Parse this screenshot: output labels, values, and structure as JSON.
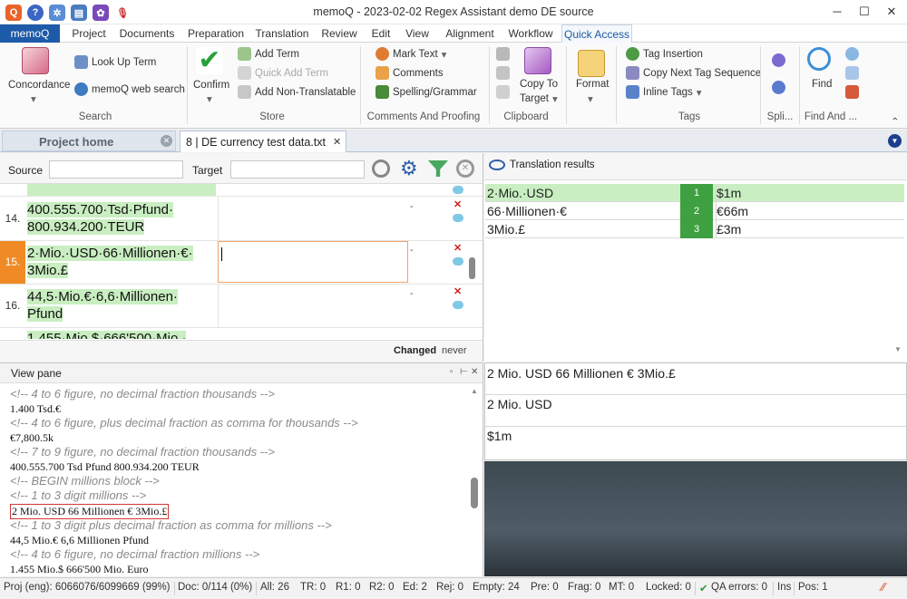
{
  "window": {
    "title": "memoQ - 2023-02-02 Regex Assistant demo DE source"
  },
  "ribbon_tabs": [
    "memoQ",
    "Project",
    "Documents",
    "Preparation",
    "Translation",
    "Review",
    "Edit",
    "View",
    "Alignment",
    "Workflow",
    "Quick Access"
  ],
  "active_tab": "Quick Access",
  "ribbon": {
    "search": {
      "concordance": "Concordance",
      "lookup": "Look Up Term",
      "web": "memoQ web search",
      "label": "Search"
    },
    "store": {
      "confirm": "Confirm",
      "add_term": "Add Term",
      "quick_add": "Quick Add Term",
      "add_nt": "Add Non-Translatable",
      "label": "Store"
    },
    "comments": {
      "mark": "Mark Text",
      "comments": "Comments",
      "spelling": "Spelling/Grammar",
      "label": "Comments And Proofing"
    },
    "clipboard": {
      "copy": "Copy To",
      "target": "Target",
      "label": "Clipboard"
    },
    "format": {
      "label": "Format"
    },
    "tags": {
      "insertion": "Tag Insertion",
      "copy_next": "Copy Next Tag Sequence",
      "inline": "Inline Tags",
      "label": "Tags"
    },
    "split": {
      "label": "Spli..."
    },
    "find": {
      "find": "Find",
      "label": "Find And ..."
    }
  },
  "doc_tabs": {
    "home": "Project home",
    "doc": "8 | DE currency test data.txt"
  },
  "filter": {
    "source_label": "Source",
    "target_label": "Target"
  },
  "grid": {
    "rows": [
      {
        "num": "14.",
        "source": "400.555.700·Tsd·Pfund· 800.934.200·TEUR",
        "status": "-"
      },
      {
        "num": "15.",
        "source": "2·Mio.·USD·66·Millionen·€· 3Mio.£",
        "status": "-"
      },
      {
        "num": "16.",
        "source": "44,5·Mio.€·6,6·Millionen· Pfund",
        "status": "-"
      },
      {
        "num": "",
        "source": "1.455·Mio.$·666'500·Mio.·",
        "status": ""
      }
    ],
    "changed_label": "Changed",
    "changed_value": "never"
  },
  "translation_results": {
    "title": "Translation results",
    "rows": [
      {
        "source": "2·Mio.·USD",
        "num": "1",
        "target": "$1m"
      },
      {
        "source": "66·Millionen·€",
        "num": "2",
        "target": "€66m"
      },
      {
        "source": "3Mio.£",
        "num": "3",
        "target": "£3m"
      }
    ]
  },
  "preview": {
    "line1": "2 Mio. USD 66 Millionen € 3Mio.£",
    "line2": "2 Mio. USD",
    "line3": "$1m"
  },
  "view_pane": {
    "title": "View pane",
    "lines": [
      {
        "type": "c",
        "text": "<!-- 4 to 6 figure, no decimal fraction thousands -->"
      },
      {
        "type": "d",
        "text": "1.400 Tsd.€"
      },
      {
        "type": "c",
        "text": "<!-- 4 to 6 figure, plus decimal fraction as comma for thousands -->"
      },
      {
        "type": "d",
        "text": "€7,800.5k"
      },
      {
        "type": "c",
        "text": "<!-- 7 to 9 figure, no decimal fraction thousands -->"
      },
      {
        "type": "d",
        "text": "400.555.700 Tsd Pfund 800.934.200 TEUR"
      },
      {
        "type": "c",
        "text": "<!-- BEGIN millions block -->"
      },
      {
        "type": "c",
        "text": "<!-- 1 to 3 digit millions -->"
      },
      {
        "type": "d",
        "text": "2 Mio. USD 66 Millionen € 3Mio.£"
      },
      {
        "type": "c",
        "text": "<!-- 1 to 3 digit plus decimal fraction as comma for millions -->"
      },
      {
        "type": "d",
        "text": "44,5 Mio.€ 6,6 Millionen Pfund"
      },
      {
        "type": "c",
        "text": "<!-- 4 to 6 figure, no decimal fraction millions -->"
      },
      {
        "type": "d",
        "text": "1.455 Mio.$ 666'500 Mio. Euro"
      }
    ]
  },
  "status_bar": {
    "proj": "Proj (eng): 6066076/6099669 (99%)",
    "doc": "Doc: 0/114 (0%)",
    "all": "All: 26",
    "tr": "TR: 0",
    "r1": "R1: 0",
    "r2": "R2: 0",
    "ed": "Ed: 2",
    "rej": "Rej: 0",
    "empty": "Empty: 24",
    "pre": "Pre: 0",
    "frag": "Frag: 0",
    "mt": "MT: 0",
    "locked": "Locked: 0",
    "qa": "QA errors: 0",
    "ins": "Ins",
    "pos": "Pos: 1"
  }
}
